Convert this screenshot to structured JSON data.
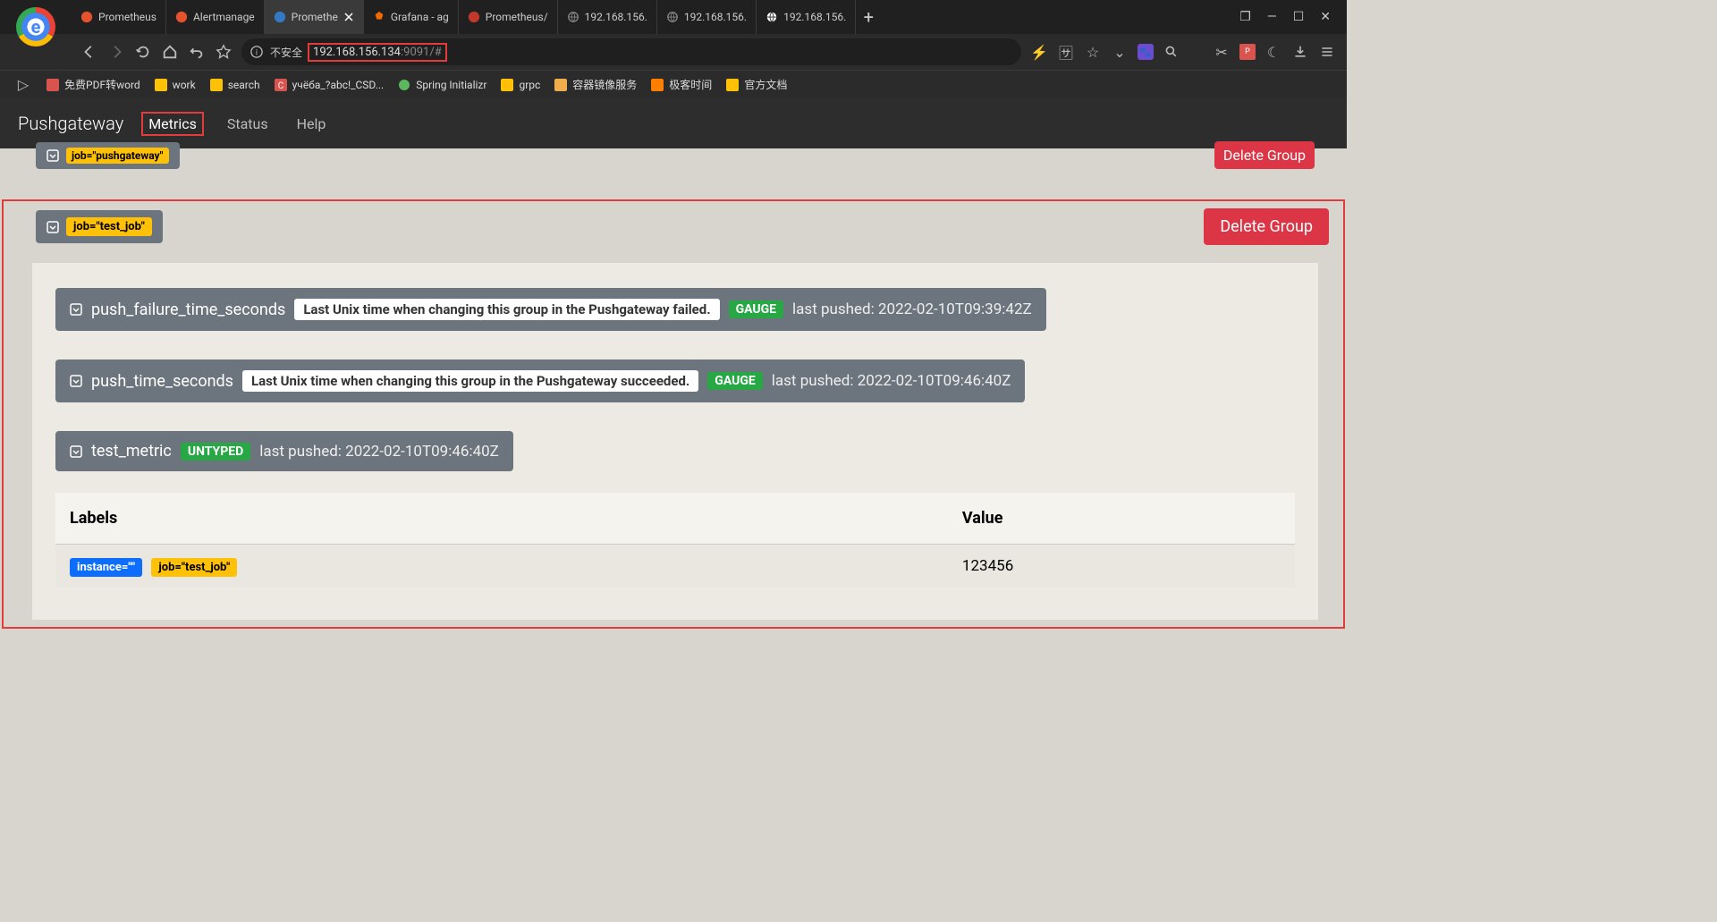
{
  "browser": {
    "tabs": [
      {
        "title": "Prometheus",
        "icon": "prom"
      },
      {
        "title": "Alertmanage",
        "icon": "prom"
      },
      {
        "title": "Promethe",
        "icon": "pg",
        "active": true
      },
      {
        "title": "Grafana - ag",
        "icon": "grafana"
      },
      {
        "title": "Prometheus/",
        "icon": "prom-red"
      },
      {
        "title": "192.168.156.",
        "icon": "globe"
      },
      {
        "title": "192.168.156.",
        "icon": "globe"
      },
      {
        "title": "192.168.156.",
        "icon": "globe2"
      }
    ],
    "security_label": "不安全",
    "url_host": "192.168.156.134",
    "url_port": ":9091/#"
  },
  "bookmarks": [
    {
      "label": "免费PDF转word",
      "icon": "pdf"
    },
    {
      "label": "work",
      "icon": "folder"
    },
    {
      "label": "search",
      "icon": "folder"
    },
    {
      "label": "учёба_?abc!_CSD...",
      "icon": "c"
    },
    {
      "label": "Spring Initializr",
      "icon": "spring"
    },
    {
      "label": "grpc",
      "icon": "folder"
    },
    {
      "label": "容器镜像服务",
      "icon": "ali"
    },
    {
      "label": "极客时间",
      "icon": "geek"
    },
    {
      "label": "官方文档",
      "icon": "folder"
    }
  ],
  "page": {
    "brand": "Pushgateway",
    "nav": {
      "metrics": "Metrics",
      "status": "Status",
      "help": "Help"
    },
    "partial_group_label": "job=\"pushgateway\"",
    "partial_delete": "Delete Group",
    "group": {
      "label": "job=\"test_job\"",
      "delete": "Delete Group"
    },
    "metrics": [
      {
        "name": "push_failure_time_seconds",
        "help": "Last Unix time when changing this group in the Pushgateway failed.",
        "type": "GAUGE",
        "pushed": "last pushed: 2022-02-10T09:39:42Z"
      },
      {
        "name": "push_time_seconds",
        "help": "Last Unix time when changing this group in the Pushgateway succeeded.",
        "type": "GAUGE",
        "pushed": "last pushed: 2022-02-10T09:46:40Z"
      },
      {
        "name": "test_metric",
        "type": "UNTYPED",
        "pushed": "last pushed: 2022-02-10T09:46:40Z"
      }
    ],
    "table": {
      "col_labels": "Labels",
      "col_value": "Value",
      "row": {
        "instance": "instance=\"\"",
        "job": "job=\"test_job\"",
        "value": "123456"
      }
    }
  }
}
